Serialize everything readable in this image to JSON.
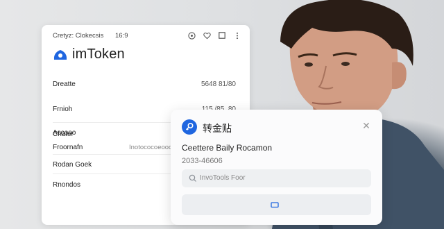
{
  "status_bar": {
    "left": "Cretyz: Clokecsis",
    "time": "16:9",
    "icons": [
      "target-icon",
      "heart-icon",
      "square-icon",
      "more-icon"
    ]
  },
  "brand": {
    "name": "imToken",
    "logo": "imtoken-logo"
  },
  "details": [
    {
      "label": "Dreatte",
      "value": "5648 81/80"
    },
    {
      "label": "Frnioh",
      "value": "115 /85, 80"
    },
    {
      "label": "Chater",
      "value": ""
    }
  ],
  "extra_rows": [
    {
      "label": "Accooo",
      "value": ""
    },
    {
      "label": "Froornafn",
      "value": "Inotococoeooo"
    },
    {
      "label": "Rodan Goek",
      "value": ""
    },
    {
      "label": "Rnondos",
      "value": ""
    }
  ],
  "dialog": {
    "title": "转金贴",
    "name": "Ceettere Baily Rocamon",
    "subtitle": "2033-46606",
    "input_placeholder": "InvoTools Foor",
    "icons": {
      "header": "key-icon",
      "close": "close-icon",
      "input": "search-icon",
      "button": "card-icon"
    }
  },
  "colors": {
    "accent": "#1f66e0",
    "card_bg": "#ffffff",
    "dialog_bg": "#fbfbfc"
  }
}
